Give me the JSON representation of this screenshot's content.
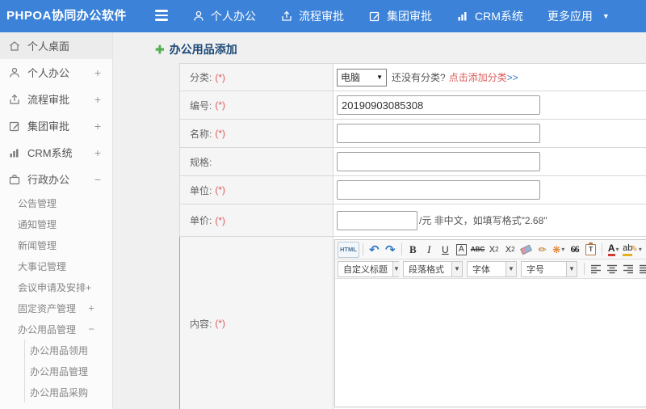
{
  "topbar": {
    "logo": "PHPOA协同办公软件",
    "nav": [
      {
        "label": "个人办公",
        "icon": "user-icon"
      },
      {
        "label": "流程审批",
        "icon": "process-icon"
      },
      {
        "label": "集团审批",
        "icon": "group-edit-icon"
      },
      {
        "label": "CRM系统",
        "icon": "crm-chart-icon"
      },
      {
        "label": "更多应用",
        "icon": "caret-down-icon"
      }
    ]
  },
  "sidebar": {
    "items": [
      {
        "label": "个人桌面",
        "icon": "home-icon"
      },
      {
        "label": "个人办公",
        "icon": "user-icon",
        "expander": "+"
      },
      {
        "label": "流程审批",
        "icon": "process-icon",
        "expander": "+"
      },
      {
        "label": "集团审批",
        "icon": "edit-icon",
        "expander": "+"
      },
      {
        "label": "CRM系统",
        "icon": "chart-icon",
        "expander": "+"
      },
      {
        "label": "行政办公",
        "icon": "briefcase-icon",
        "expander": "−"
      }
    ],
    "admin_items": [
      {
        "label": "公告管理"
      },
      {
        "label": "通知管理"
      },
      {
        "label": "新闻管理"
      },
      {
        "label": "大事记管理"
      },
      {
        "label": "会议申请及安排+"
      },
      {
        "label": "固定资产管理",
        "expander": "+"
      },
      {
        "label": "办公用品管理",
        "expander": "−"
      }
    ],
    "supplies_items": [
      {
        "label": "办公用品领用"
      },
      {
        "label": "办公用品管理"
      },
      {
        "label": "办公用品采购"
      }
    ]
  },
  "page": {
    "title": "办公用品添加"
  },
  "form": {
    "category": {
      "label": "分类:",
      "required": "(*)",
      "value": "电脑",
      "hint": "还没有分类?",
      "link": "点击添加分类",
      "link_suffix": ">>"
    },
    "code": {
      "label": "编号:",
      "required": "(*)",
      "value": "20190903085308"
    },
    "name": {
      "label": "名称:",
      "required": "(*)",
      "value": ""
    },
    "spec": {
      "label": "规格:",
      "value": ""
    },
    "unit": {
      "label": "单位:",
      "required": "(*)",
      "value": ""
    },
    "price": {
      "label": "单价:",
      "required": "(*)",
      "value": "",
      "suffix": "/元 非中文，如填写格式\"2.68\""
    },
    "content": {
      "label": "内容:",
      "required": "(*)"
    }
  },
  "editor": {
    "source": "HTML",
    "bold": "B",
    "italic": "I",
    "underline": "U",
    "char_border": "A",
    "strike": "ABC",
    "sup_base": "X",
    "sup_mark": "2",
    "sub_base": "X",
    "sub_mark": "2",
    "quote": "66",
    "paste_letter": "T",
    "font_color": "A",
    "back_color": "ab",
    "dropdowns": [
      {
        "label": "自定义标题"
      },
      {
        "label": "段落格式"
      },
      {
        "label": "字体"
      },
      {
        "label": "字号"
      }
    ]
  },
  "colors": {
    "topbar_blue": "#3b82d8",
    "title_navy": "#1c4a77",
    "required_red": "#e05a5a",
    "link_blue": "#2d7ad2",
    "link_red": "#dd5c5c"
  }
}
